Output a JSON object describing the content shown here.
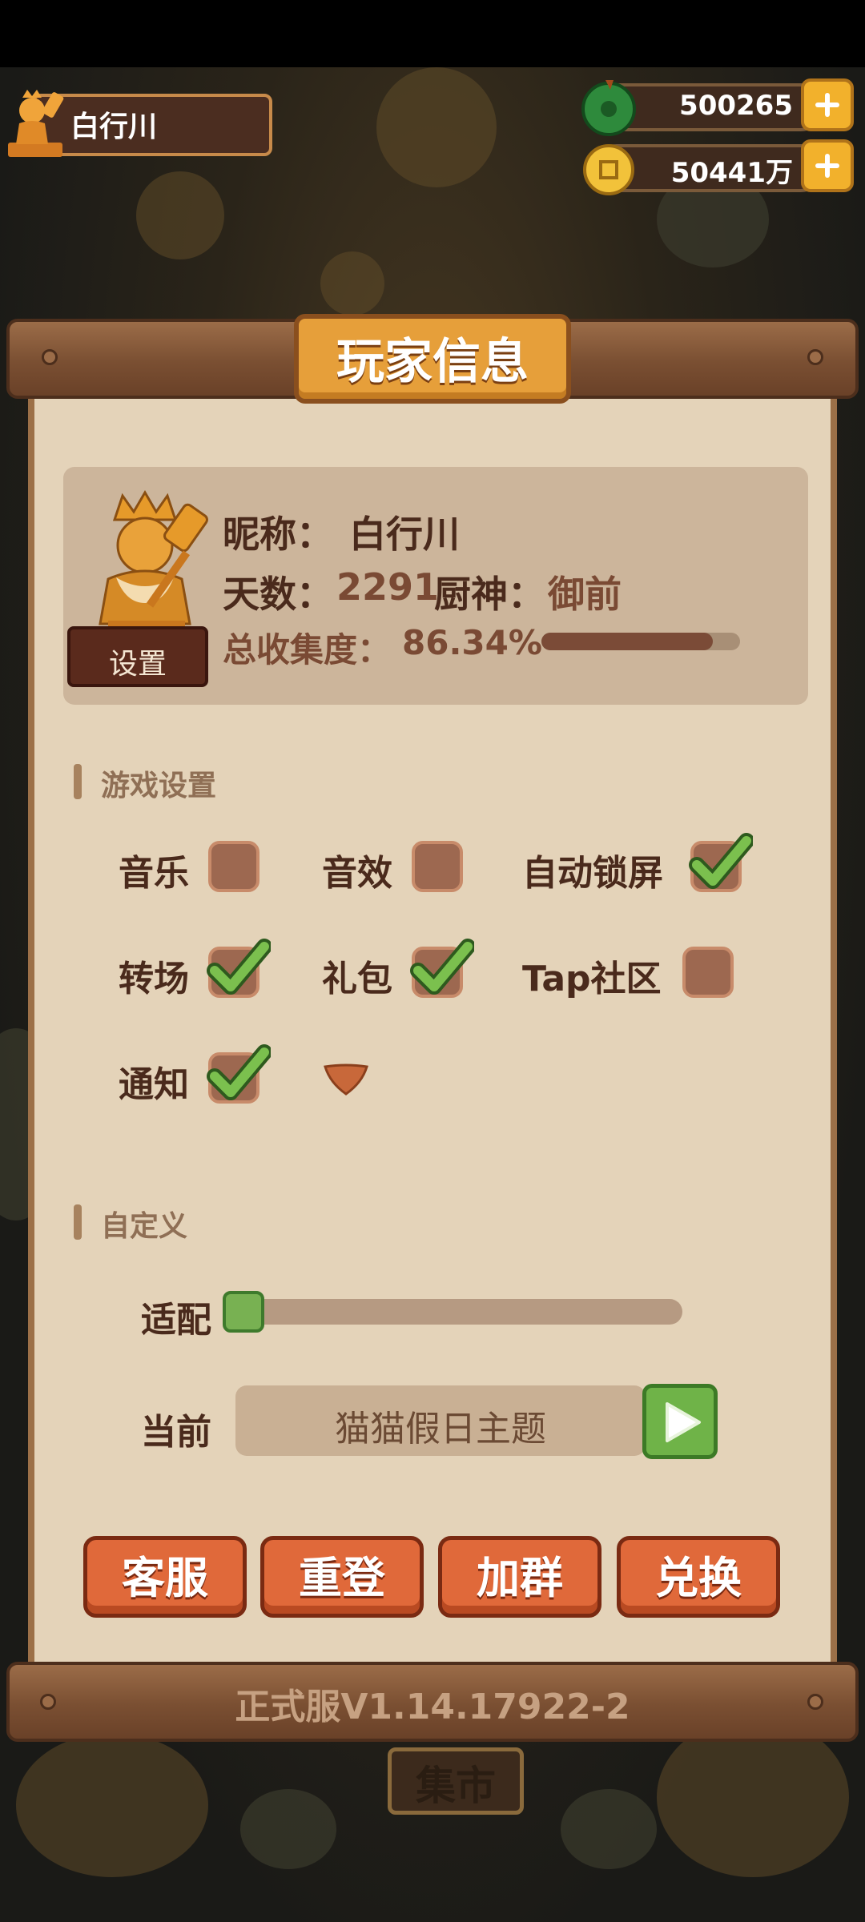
{
  "hud": {
    "player_name": "白行川",
    "jade": "500265",
    "coins": "50441万"
  },
  "panel": {
    "title": "玩家信息",
    "settings_button": "设置",
    "nickname_label": "昵称：",
    "nickname": "白行川",
    "days_label": "天数：",
    "days": "2291",
    "chef_label": "厨神：",
    "chef": "御前",
    "collection_label": "总收集度：",
    "collection": "86.34%",
    "collection_fraction": 0.8634
  },
  "game_settings": {
    "heading": "游戏设置",
    "options": [
      {
        "label": "音乐",
        "checked": false
      },
      {
        "label": "音效",
        "checked": false
      },
      {
        "label": "自动锁屏",
        "checked": true
      },
      {
        "label": "转场",
        "checked": true
      },
      {
        "label": "礼包",
        "checked": true
      },
      {
        "label": "Tap社区",
        "checked": false
      },
      {
        "label": "通知",
        "checked": true
      }
    ]
  },
  "custom": {
    "heading": "自定义",
    "fit_label": "适配",
    "fit_value": 0,
    "current_label": "当前",
    "theme": "猫猫假日主题"
  },
  "actions": {
    "service": "客服",
    "relogin": "重登",
    "join_group": "加群",
    "redeem": "兑换"
  },
  "version": "正式服V1.14.17922-2",
  "market": "集市",
  "colors": {
    "panel_bg": "#e4d3b9",
    "wood": "#7a4f32",
    "accent_orange": "#e0693a",
    "check_green": "#6fb348"
  }
}
